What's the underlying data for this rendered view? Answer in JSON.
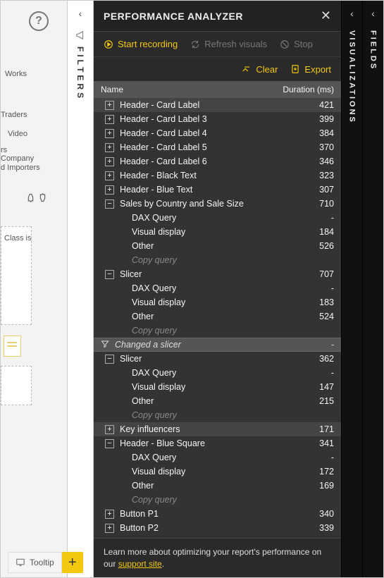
{
  "perf": {
    "title": "PERFORMANCE ANALYZER",
    "toolbar": {
      "start": "Start recording",
      "refresh": "Refresh visuals",
      "stop": "Stop",
      "clear": "Clear",
      "export": "Export"
    },
    "columns": {
      "name": "Name",
      "duration": "Duration (ms)"
    },
    "rows": [
      {
        "type": "node",
        "expanded": false,
        "label": "Header - Card Label",
        "duration": "421",
        "selected": true
      },
      {
        "type": "node",
        "expanded": false,
        "label": "Header - Card Label 3",
        "duration": "399"
      },
      {
        "type": "node",
        "expanded": false,
        "label": "Header - Card Label 4",
        "duration": "384"
      },
      {
        "type": "node",
        "expanded": false,
        "label": "Header - Card Label 5",
        "duration": "370"
      },
      {
        "type": "node",
        "expanded": false,
        "label": "Header - Card Label 6",
        "duration": "346"
      },
      {
        "type": "node",
        "expanded": false,
        "label": "Header - Black Text",
        "duration": "323"
      },
      {
        "type": "node",
        "expanded": false,
        "label": "Header - Blue Text",
        "duration": "307"
      },
      {
        "type": "node",
        "expanded": true,
        "label": "Sales by Country and Sale Size",
        "duration": "710"
      },
      {
        "type": "child",
        "label": "DAX Query",
        "duration": "-"
      },
      {
        "type": "child",
        "label": "Visual display",
        "duration": "184"
      },
      {
        "type": "child",
        "label": "Other",
        "duration": "526"
      },
      {
        "type": "copy",
        "label": "Copy query"
      },
      {
        "type": "node",
        "expanded": true,
        "label": "Slicer",
        "duration": "707"
      },
      {
        "type": "child",
        "label": "DAX Query",
        "duration": "-"
      },
      {
        "type": "child",
        "label": "Visual display",
        "duration": "183"
      },
      {
        "type": "child",
        "label": "Other",
        "duration": "524"
      },
      {
        "type": "copy",
        "label": "Copy query"
      },
      {
        "type": "separator",
        "label": "Changed a slicer",
        "duration": "-"
      },
      {
        "type": "node",
        "expanded": true,
        "label": "Slicer",
        "duration": "362"
      },
      {
        "type": "child",
        "label": "DAX Query",
        "duration": "-"
      },
      {
        "type": "child",
        "label": "Visual display",
        "duration": "147"
      },
      {
        "type": "child",
        "label": "Other",
        "duration": "215"
      },
      {
        "type": "copy",
        "label": "Copy query"
      },
      {
        "type": "node",
        "expanded": false,
        "label": "Key influencers",
        "duration": "171",
        "selected": true
      },
      {
        "type": "node",
        "expanded": true,
        "label": "Header - Blue Square",
        "duration": "341"
      },
      {
        "type": "child",
        "label": "DAX Query",
        "duration": "-"
      },
      {
        "type": "child",
        "label": "Visual display",
        "duration": "172"
      },
      {
        "type": "child",
        "label": "Other",
        "duration": "169"
      },
      {
        "type": "copy",
        "label": "Copy query"
      },
      {
        "type": "node",
        "expanded": false,
        "label": "Button P1",
        "duration": "340"
      },
      {
        "type": "node",
        "expanded": false,
        "label": "Button P2",
        "duration": "339"
      }
    ],
    "footer_prefix": "Learn more about optimizing your report's performance on our ",
    "footer_link": "support site",
    "footer_suffix": "."
  },
  "filters_label": "FILTERS",
  "viz_label": "VISUALIZATIONS",
  "fields_label": "FIELDS",
  "tooltip_tab": "Tooltip",
  "canvas": {
    "t1": "Works",
    "t2": "Traders",
    "t3": "Video",
    "t4": "rs",
    "t5": "Company",
    "t6": "d Importers",
    "t7": "Class is"
  }
}
